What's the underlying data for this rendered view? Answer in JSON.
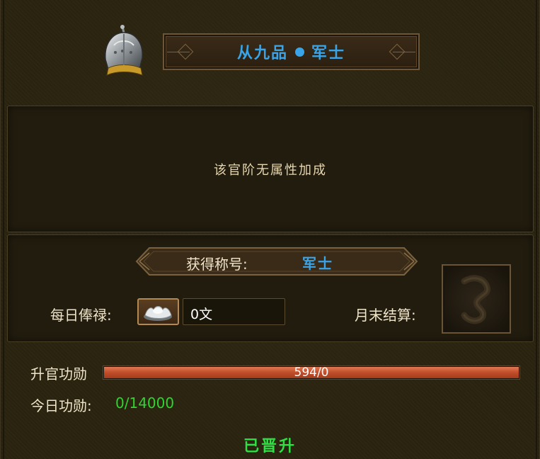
{
  "rank": {
    "grade": "从九品",
    "title": "军士",
    "accent_color": "#3aa4e8"
  },
  "attributes": {
    "text": "该官阶无属性加成"
  },
  "honor_title": {
    "label": "获得称号:",
    "value": "军士"
  },
  "salary": {
    "label": "每日俸禄:",
    "icon": "silver-ingot-icon",
    "value": "0文"
  },
  "settlement": {
    "label": "月末结算:",
    "icon": "seal-medal-icon"
  },
  "promotion_merit": {
    "label": "升官功勋",
    "value_text": "594/0",
    "fill_fraction": 1.0,
    "bar_color": "#c4502c"
  },
  "today_merit": {
    "label": "今日功勋:",
    "value": "0/14000",
    "value_color": "#2fd42f"
  },
  "status": {
    "text": "已晋升",
    "color": "#2ee043"
  },
  "icons": {
    "rank_icon": "iron-helmet-icon"
  }
}
